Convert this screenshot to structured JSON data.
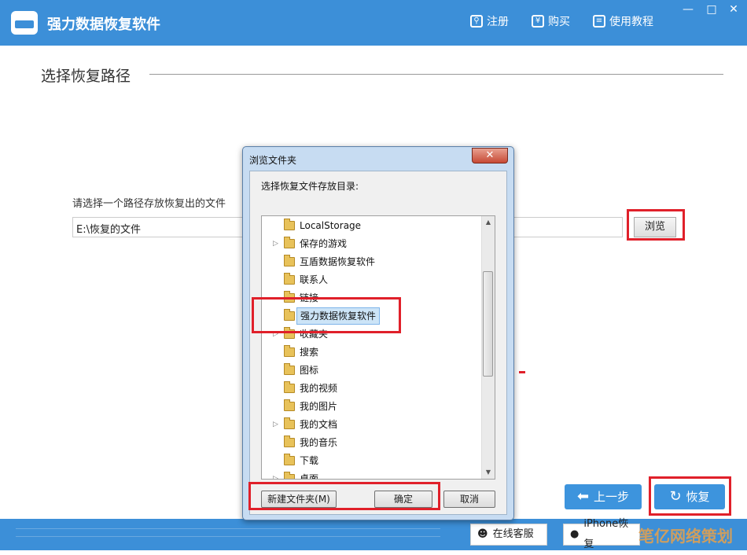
{
  "app": {
    "title": "强力数据恢复软件"
  },
  "header": {
    "menu": [
      {
        "label": "注册",
        "icon": "search-icon"
      },
      {
        "label": "购买",
        "icon": "yen-icon"
      },
      {
        "label": "使用教程",
        "icon": "doc-icon"
      }
    ],
    "window_controls": {
      "minimize": "—",
      "maximize": "□",
      "close": "✕"
    }
  },
  "main": {
    "section_title": "选择恢复路径",
    "path_label": "请选择一个路径存放恢复出的文件",
    "path_value": "E:\\恢复的文件",
    "browse_label": "浏览"
  },
  "dialog": {
    "title": "浏览文件夹",
    "close_label": "✕",
    "prompt": "选择恢复文件存放目录:",
    "tree": [
      {
        "label": "LocalStorage",
        "expandable": false
      },
      {
        "label": "保存的游戏",
        "expandable": true
      },
      {
        "label": "互盾数据恢复软件",
        "expandable": false
      },
      {
        "label": "联系人",
        "expandable": false
      },
      {
        "label": "链接",
        "expandable": false
      },
      {
        "label": "强力数据恢复软件",
        "expandable": false,
        "selected": true
      },
      {
        "label": "收藏夹",
        "expandable": true
      },
      {
        "label": "搜索",
        "expandable": false
      },
      {
        "label": "图标",
        "expandable": false
      },
      {
        "label": "我的视频",
        "expandable": false
      },
      {
        "label": "我的图片",
        "expandable": false
      },
      {
        "label": "我的文档",
        "expandable": true
      },
      {
        "label": "我的音乐",
        "expandable": false
      },
      {
        "label": "下载",
        "expandable": false
      },
      {
        "label": "桌面",
        "expandable": true
      }
    ],
    "buttons": {
      "new_folder": "新建文件夹(M)",
      "ok": "确定",
      "cancel": "取消"
    }
  },
  "nav": {
    "back": "上一步",
    "recover": "恢复"
  },
  "footer": {
    "online_service": "在线客服",
    "iphone_recovery": "iPhone恢复",
    "watermark": "笔亿网络策划"
  },
  "colors": {
    "brand": "#3c8fd8",
    "highlight": "#e0202a"
  }
}
